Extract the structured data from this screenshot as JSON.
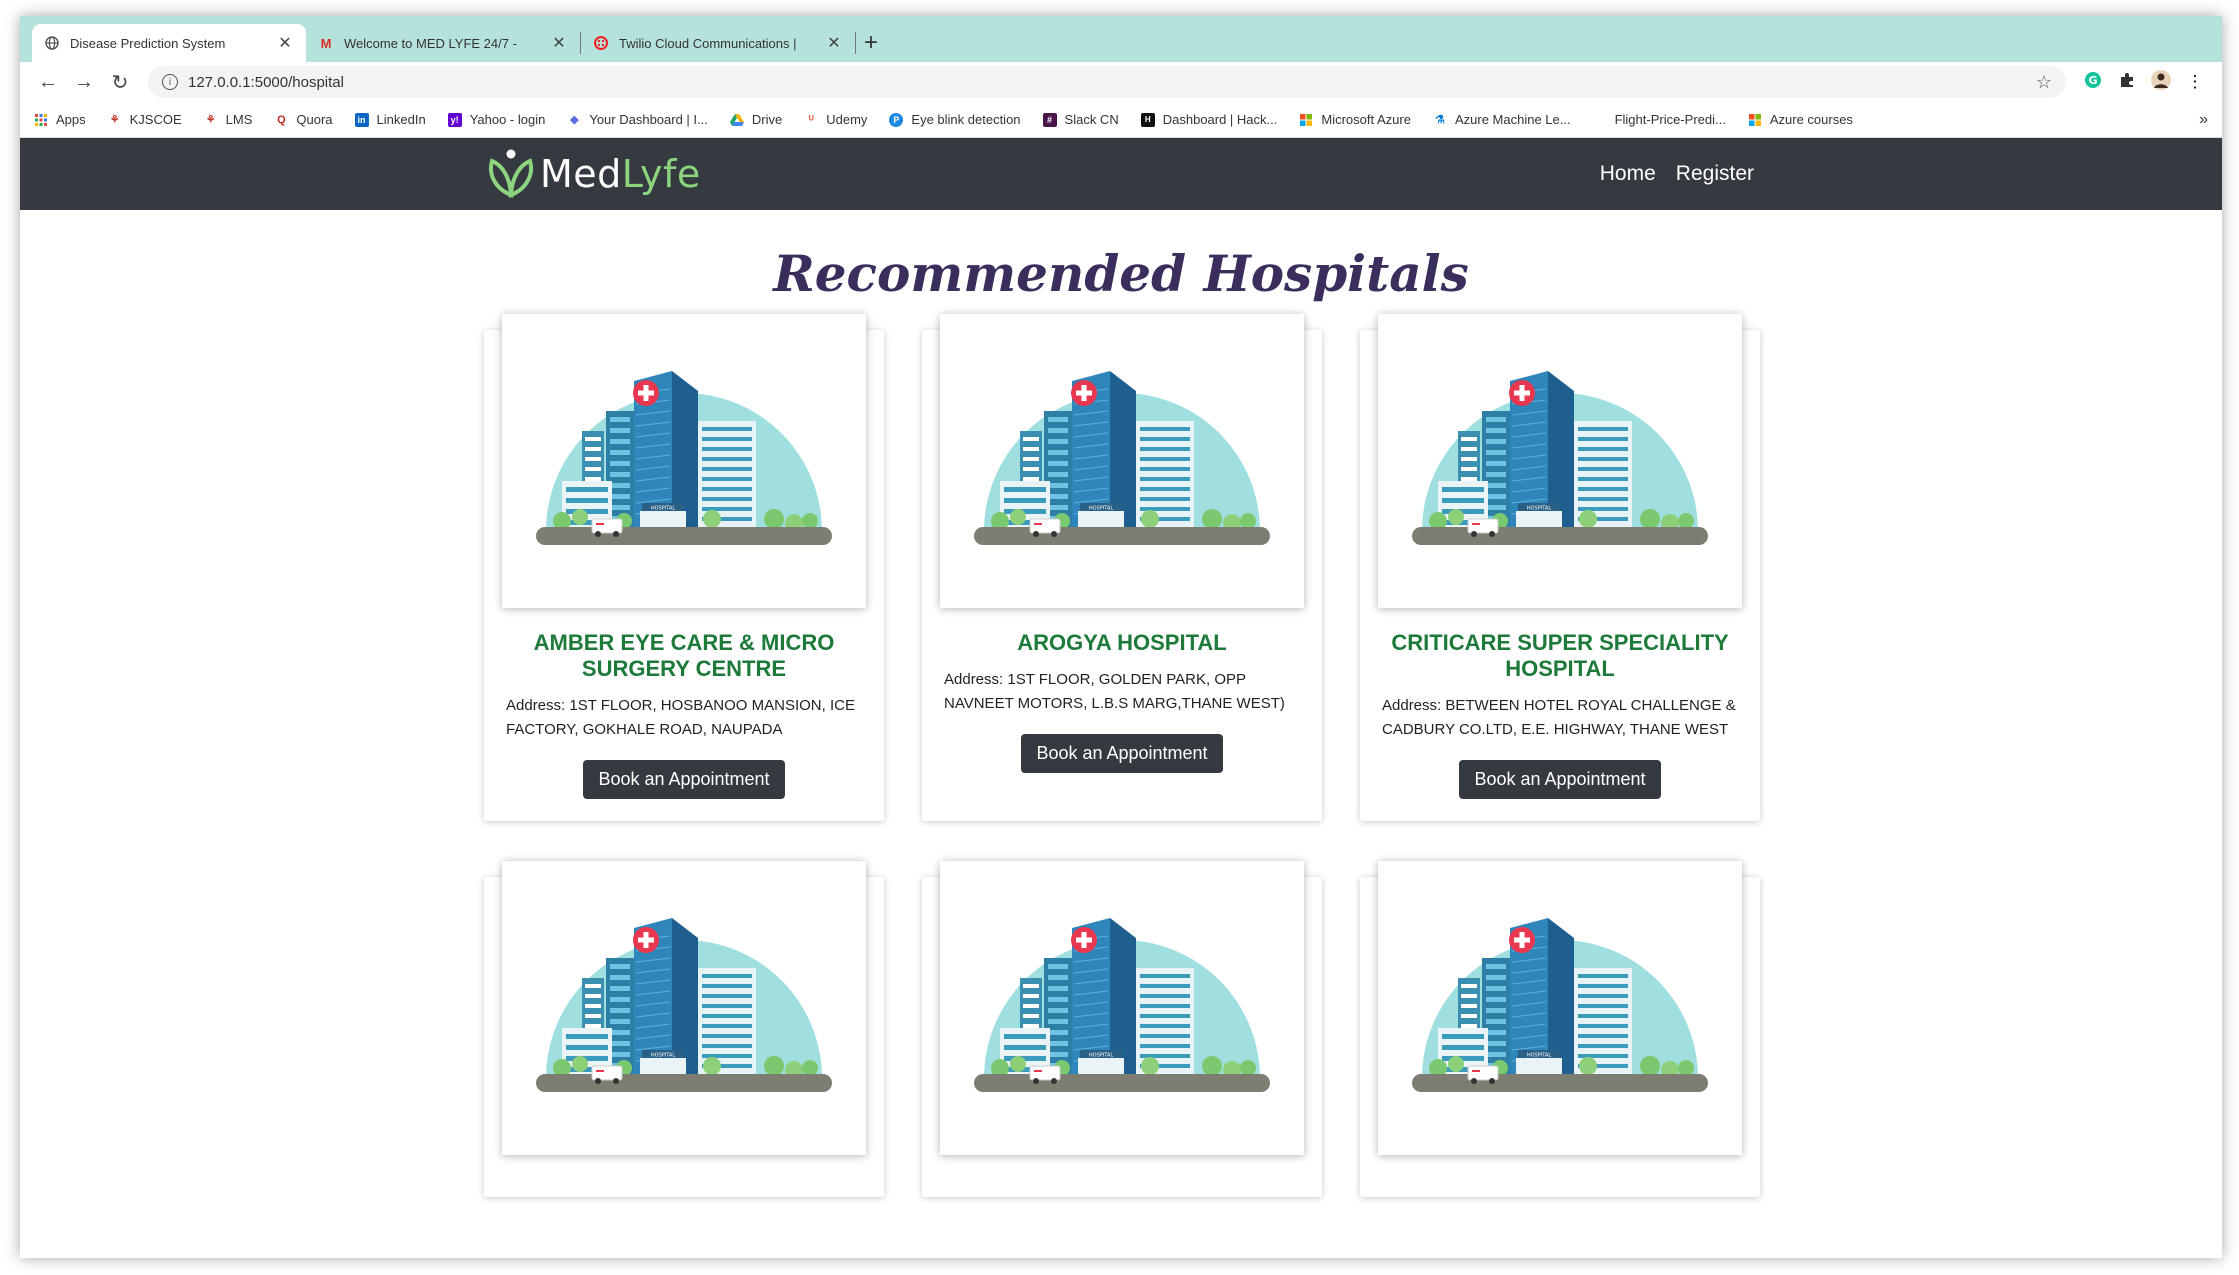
{
  "browser": {
    "tabs": [
      {
        "title": "Disease Prediction System",
        "icon": "globe-icon",
        "active": true
      },
      {
        "title": "Welcome to MED LYFE 24/7 - ",
        "icon": "gmail-icon",
        "active": false
      },
      {
        "title": "Twilio Cloud Communications |",
        "icon": "twilio-icon",
        "active": false
      }
    ],
    "url": "127.0.0.1:5000/hospital",
    "bookmarks": [
      {
        "label": "Apps",
        "icon": "apps-grid-icon"
      },
      {
        "label": "KJSCOE",
        "icon": "kjscoe-icon"
      },
      {
        "label": "LMS",
        "icon": "lms-icon"
      },
      {
        "label": "Quora",
        "icon": "quora-icon"
      },
      {
        "label": "LinkedIn",
        "icon": "linkedin-icon"
      },
      {
        "label": "Yahoo - login",
        "icon": "yahoo-icon"
      },
      {
        "label": "Your Dashboard | I...",
        "icon": "dashboard-icon"
      },
      {
        "label": "Drive",
        "icon": "drive-icon"
      },
      {
        "label": "Udemy",
        "icon": "udemy-icon"
      },
      {
        "label": "Eye blink detection",
        "icon": "eye-blink-icon"
      },
      {
        "label": "Slack CN",
        "icon": "slack-icon"
      },
      {
        "label": "Dashboard | Hack...",
        "icon": "hackerrank-icon"
      },
      {
        "label": "Microsoft Azure",
        "icon": "microsoft-icon"
      },
      {
        "label": "Azure Machine Le...",
        "icon": "azure-ml-icon"
      },
      {
        "label": "Flight-Price-Predi...",
        "icon": "flight-icon"
      },
      {
        "label": "Azure courses",
        "icon": "microsoft-icon"
      }
    ]
  },
  "site": {
    "brand_prefix": "Med",
    "brand_suffix": "Lyfe",
    "nav": {
      "home": "Home",
      "register": "Register"
    },
    "page_title": "Recommended Hospitals",
    "hospitals": [
      {
        "name": "AMBER EYE CARE & MICRO SURGERY CENTRE",
        "address": "Address: 1ST FLOOR, HOSBANOO MANSION, ICE FACTORY, GOKHALE ROAD, NAUPADA",
        "button": "Book an Appointment"
      },
      {
        "name": "AROGYA HOSPITAL",
        "address": "Address: 1ST FLOOR, GOLDEN PARK, OPP NAVNEET MOTORS, L.B.S MARG,THANE WEST)",
        "button": "Book an Appointment"
      },
      {
        "name": "CRITICARE SUPER SPECIALITY HOSPITAL",
        "address": "Address: BETWEEN HOTEL ROYAL CHALLENGE & CADBURY CO.LTD, E.E. HIGHWAY, THANE WEST",
        "button": "Book an Appointment"
      }
    ],
    "illustration_label": "HOSPITAL"
  },
  "colors": {
    "navbar": "#343a40",
    "title": "#3b2d5c",
    "hospital_name": "#1d7a3a",
    "tabstrip": "#b6e2de"
  }
}
